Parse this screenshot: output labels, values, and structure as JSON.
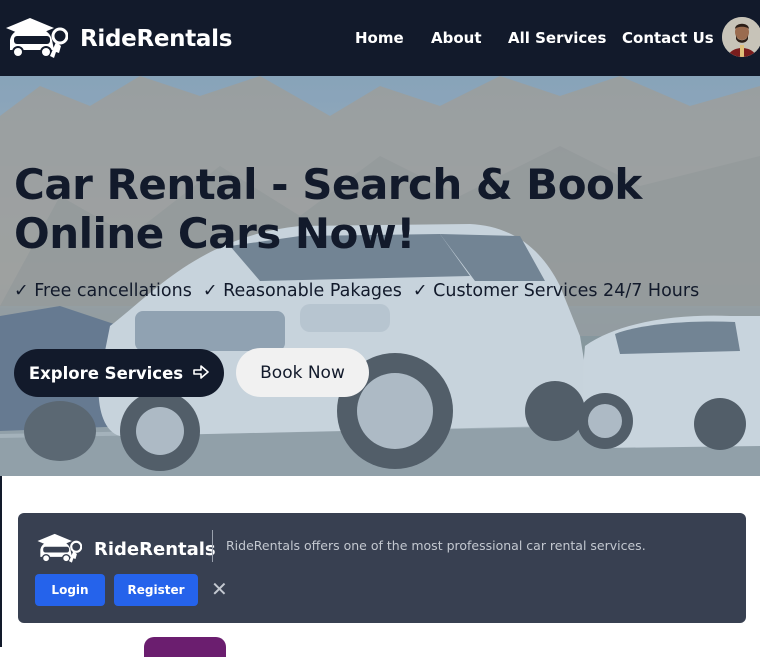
{
  "brand": {
    "name": "RideRentals",
    "logo_icon": "car-key-icon"
  },
  "nav": {
    "links": [
      "Home",
      "About",
      "All Services",
      "Contact Us"
    ],
    "avatar_icon": "user-avatar"
  },
  "hero": {
    "title_line1": "Car Rental - Search & Book",
    "title_line2": "Online Cars Now!",
    "features": [
      "✓ Free cancellations",
      "✓ Reasonable Pakages",
      "✓ Customer Services 24/7 Hours"
    ],
    "explore_label": "Explore Services",
    "explore_icon": "arrow-right-icon",
    "book_label": "Book Now"
  },
  "banner": {
    "brand_name": "RideRentals",
    "text": "RideRentals offers one of the most professional car rental services.",
    "login_label": "Login",
    "register_label": "Register",
    "close_label": "✕"
  },
  "colors": {
    "navy": "#121a2b",
    "banner_bg": "#384051",
    "blue": "#2563eb",
    "purple": "#6b1e6f"
  }
}
